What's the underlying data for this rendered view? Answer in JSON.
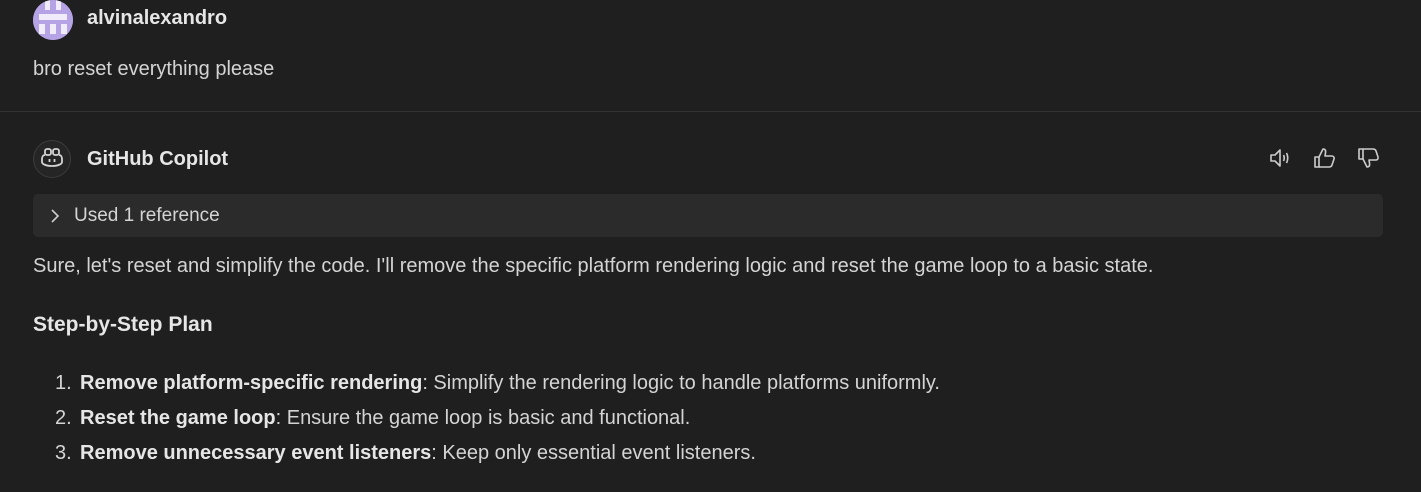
{
  "user_message": {
    "username": "alvinalexandro",
    "text": "bro reset everything please"
  },
  "copilot_message": {
    "name": "GitHub Copilot",
    "actions": [
      "speaker-icon",
      "thumbs-up-icon",
      "thumbs-down-icon"
    ],
    "reference": {
      "label": "Used 1 reference"
    },
    "intro": "Sure, let's reset and simplify the code. I'll remove the specific platform rendering logic and reset the game loop to a basic state.",
    "plan_heading": "Step-by-Step Plan",
    "plan_items": [
      {
        "number": "1.",
        "title": "Remove platform-specific rendering",
        "desc": ": Simplify the rendering logic to handle platforms uniformly."
      },
      {
        "number": "2.",
        "title": "Reset the game loop",
        "desc": ": Ensure the game loop is basic and functional."
      },
      {
        "number": "3.",
        "title": "Remove unnecessary event listeners",
        "desc": ": Keep only essential event listeners."
      }
    ]
  },
  "colors": {
    "background": "#1f1f1f",
    "reference_bg": "#2b2b2c",
    "avatar_user": "#b6a3e6",
    "text": "#d4d4d4"
  }
}
